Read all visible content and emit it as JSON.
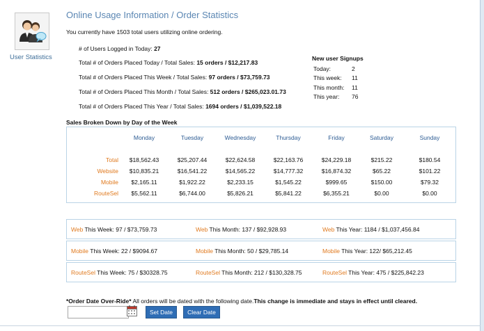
{
  "sidebar": {
    "caption": "User Statistics"
  },
  "header": {
    "title": "Online Usage Information / Order Statistics",
    "intro": "You currently have 1503 total users utilizing online ordering."
  },
  "stats": [
    {
      "label": "# of Users Logged in Today: ",
      "value": "27"
    },
    {
      "label": "Total # of Orders Placed Today / Total Sales: ",
      "value": "15 orders / $12,217.83"
    },
    {
      "label": "Total # of Orders Placed This Week / Total Sales: ",
      "value": "97 orders / $73,759.73"
    },
    {
      "label": "Total # of Orders Placed This Month / Total Sales: ",
      "value": "512 orders / $265,023.01.73"
    },
    {
      "label": "Total # of Orders Placed This Year / Total Sales: ",
      "value": "1694 orders / $1,039,522.18"
    }
  ],
  "signups": {
    "title": "New user Signups",
    "rows": [
      {
        "label": "Today:",
        "value": "2"
      },
      {
        "label": "This week:",
        "value": "11"
      },
      {
        "label": "This month:",
        "value": "11"
      },
      {
        "label": "This year:",
        "value": "76"
      }
    ]
  },
  "by_day": {
    "title": "Sales Broken Down by Day of the Week",
    "days": [
      "Monday",
      "Tuesday",
      "Wednesday",
      "Thursday",
      "Friday",
      "Saturday",
      "Sunday"
    ],
    "rows": [
      {
        "label": "Total",
        "values": [
          "$18,562.43",
          "$25,207.44",
          "$22,624.58",
          "$22,163.76",
          "$24,229.18",
          "$215.22",
          "$180.54"
        ]
      },
      {
        "label": "Website",
        "values": [
          "$10,835.21",
          "$16,541.22",
          "$14,565.22",
          "$14,777.32",
          "$16,874.32",
          "$65.22",
          "$101.22"
        ]
      },
      {
        "label": "Mobile",
        "values": [
          "$2,165.11",
          "$1,922.22",
          "$2,233.15",
          "$1,545.22",
          "$999.65",
          "$150.00",
          "$79.32"
        ]
      },
      {
        "label": "RouteSel",
        "values": [
          "$5,562.11",
          "$6,744.00",
          "$5,826.21",
          "$5,841.22",
          "$6,355.21",
          "$0.00",
          "$0.00"
        ]
      }
    ]
  },
  "summaries": [
    {
      "cells": [
        {
          "hl": "Web",
          "label": " This Week:",
          "value": "  97 / $73,759.73"
        },
        {
          "hl": "Web",
          "label": " This Month:",
          "value": "  137 / $92,928.93"
        },
        {
          "hl": "Web",
          "label": " This Year:",
          "value": "  1184 / $1,037,456.84"
        }
      ]
    },
    {
      "cells": [
        {
          "hl": "Mobile",
          "label": " This Week:",
          "value": "  22 / $9094.67"
        },
        {
          "hl": "Mobile",
          "label": " This Month:",
          "value": " 50 / $29,785.14"
        },
        {
          "hl": "Mobile",
          "label": " This Year:",
          "value": " 122/ $65,212.45"
        }
      ]
    },
    {
      "cells": [
        {
          "hl": "RouteSel",
          "label": " This Week:",
          "value": " 75 / $30328.75"
        },
        {
          "hl": "RouteSel",
          "label": " This Month:",
          "value": " 212 / $130,328.75"
        },
        {
          "hl": "RouteSel",
          "label": " This Year:",
          "value": "  475 / $225,842.23"
        }
      ]
    }
  ],
  "override": {
    "label": "*Order Date Over-Ride*",
    "text": " All orders will be dated with the following date.",
    "note": "This change is immediate and stays in effect until cleared.",
    "date_value": "",
    "set_label": "Set Date",
    "clear_label": "Clear Date"
  },
  "colors": {
    "accent": "#e07a1f",
    "title": "#5a86b3",
    "button": "#2f6db5",
    "border": "#b9d3e6"
  }
}
